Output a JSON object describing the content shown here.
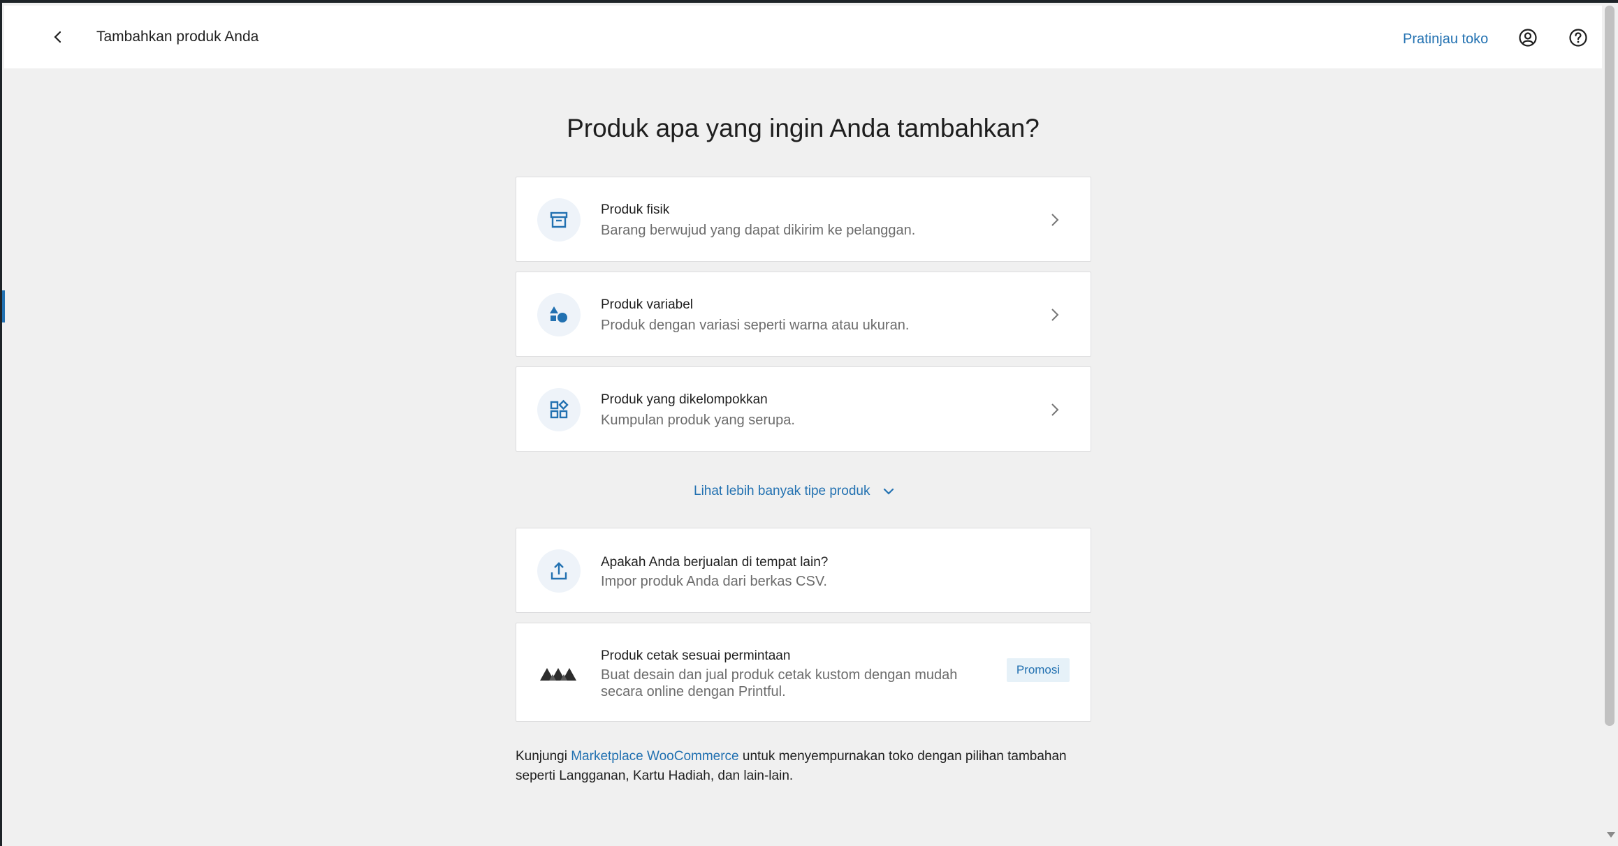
{
  "header": {
    "title": "Tambahkan produk Anda",
    "preview_label": "Pratinjau toko"
  },
  "main": {
    "heading": "Produk apa yang ingin Anda tambahkan?",
    "product_types": [
      {
        "title": "Produk fisik",
        "description": "Barang berwujud yang dapat dikirim ke pelanggan.",
        "icon": "archive-box-icon"
      },
      {
        "title": "Produk variabel",
        "description": "Produk dengan variasi seperti warna atau ukuran.",
        "icon": "shapes-icon"
      },
      {
        "title": "Produk yang dikelompokkan",
        "description": "Kumpulan produk yang serupa.",
        "icon": "grid-blocks-icon"
      }
    ],
    "more_types_label": "Lihat lebih banyak tipe produk",
    "import_card": {
      "title": "Apakah Anda berjualan di tempat lain?",
      "description": "Impor produk Anda dari berkas CSV.",
      "icon": "upload-icon"
    },
    "print_card": {
      "title": "Produk cetak sesuai permintaan",
      "description_line1": "Buat desain dan jual produk cetak kustom dengan mudah",
      "description_line2": "secara online dengan Printful.",
      "badge": "Promosi",
      "icon": "printful-logo"
    },
    "footer": {
      "before": "Kunjungi ",
      "link": "Marketplace WooCommerce",
      "after_line1": " untuk menyempurnakan toko dengan pilihan tambahan",
      "line2": "seperti Langganan, Kartu Hadiah, dan lain-lain."
    }
  },
  "colors": {
    "accent": "#2271b1",
    "page_bg": "#f0f0f0",
    "card_bg": "#ffffff",
    "icon_bg": "#eef3f9"
  }
}
